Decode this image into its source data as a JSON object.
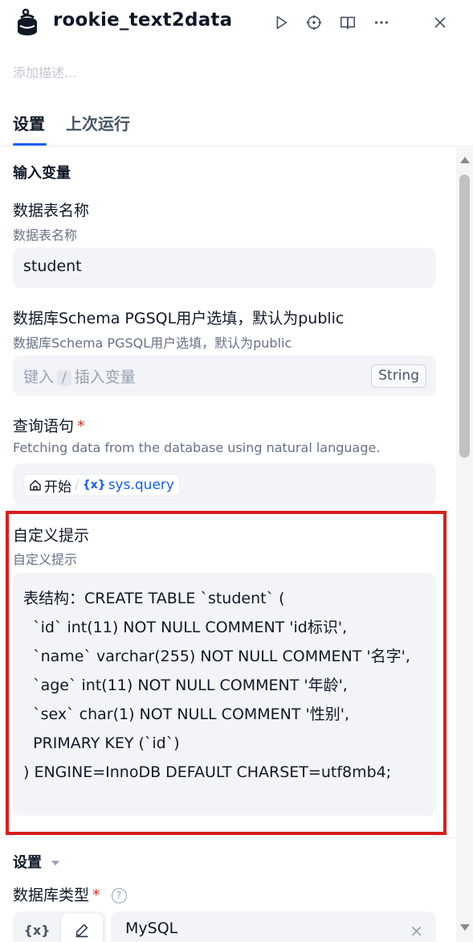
{
  "header": {
    "title": "rookie_text2data",
    "icons": [
      "app-logo-icon",
      "run-icon",
      "crosshair-icon",
      "book-icon",
      "more-icon",
      "close-icon"
    ]
  },
  "description": {
    "placeholder": "添加描述..."
  },
  "tabs": [
    {
      "label": "设置",
      "active": true
    },
    {
      "label": "上次运行",
      "active": false
    }
  ],
  "input_vars": {
    "section_title": "输入变量",
    "table_name": {
      "label": "数据表名称",
      "sub": "数据表名称",
      "value": "student"
    },
    "schema": {
      "label": "数据库Schema PGSQL用户选填，默认为public",
      "sub": "数据库Schema PGSQL用户选填，默认为public",
      "placeholder_pre": "键入",
      "placeholder_slash": "/",
      "placeholder_post": "插入变量",
      "type_badge": "String"
    },
    "query": {
      "label": "查询语句",
      "required_mark": "*",
      "sub": "Fetching data from the database using natural language.",
      "chip_node": "开始",
      "chip_sep": "/",
      "chip_var_icon": "{x}",
      "chip_var": "sys.query"
    },
    "custom_prompt": {
      "label": "自定义提示",
      "sub": "自定义提示",
      "value": "表结构：CREATE TABLE `student` (\n  `id` int(11) NOT NULL COMMENT 'id标识',\n  `name` varchar(255) NOT NULL COMMENT '名字',\n  `age` int(11) NOT NULL COMMENT '年龄',\n  `sex` char(1) NOT NULL COMMENT '性别',\n  PRIMARY KEY (`id`)\n) ENGINE=InnoDB DEFAULT CHARSET=utf8mb4;"
    }
  },
  "settings": {
    "section_title": "设置",
    "db_type": {
      "label": "数据库类型",
      "required_mark": "*",
      "help": "?",
      "toggle_var": "{x}",
      "value": "MySQL",
      "clear": "×"
    }
  },
  "colors": {
    "accent": "#155eef",
    "highlight": "#d81e1e",
    "required": "#d92d20"
  }
}
